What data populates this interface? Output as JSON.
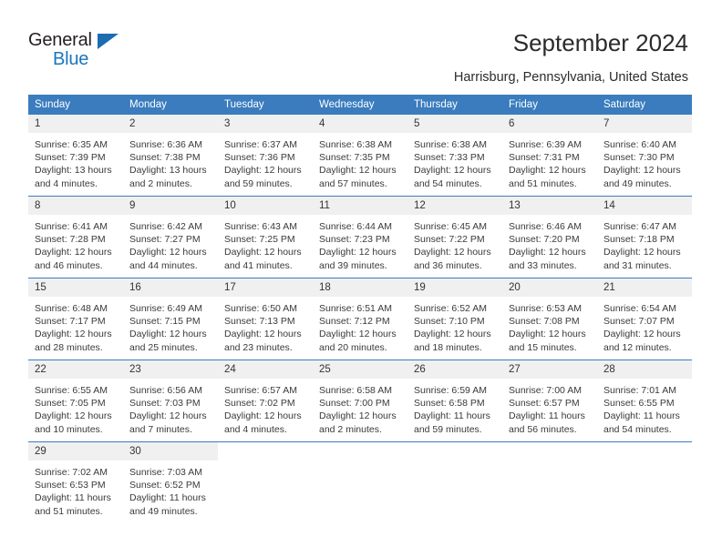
{
  "brand": {
    "name_top": "General",
    "name_bottom": "Blue",
    "triangle_color": "#1b6cb0",
    "blue_color": "#1b75bb"
  },
  "header": {
    "title": "September 2024",
    "subtitle": "Harrisburg, Pennsylvania, United States"
  },
  "calendar": {
    "header_bg": "#3a7cbe",
    "daynum_bg": "#f0f0f0",
    "weekdays": [
      "Sunday",
      "Monday",
      "Tuesday",
      "Wednesday",
      "Thursday",
      "Friday",
      "Saturday"
    ],
    "weeks": [
      [
        {
          "day": "1",
          "sunrise": "Sunrise: 6:35 AM",
          "sunset": "Sunset: 7:39 PM",
          "daylight1": "Daylight: 13 hours",
          "daylight2": "and 4 minutes."
        },
        {
          "day": "2",
          "sunrise": "Sunrise: 6:36 AM",
          "sunset": "Sunset: 7:38 PM",
          "daylight1": "Daylight: 13 hours",
          "daylight2": "and 2 minutes."
        },
        {
          "day": "3",
          "sunrise": "Sunrise: 6:37 AM",
          "sunset": "Sunset: 7:36 PM",
          "daylight1": "Daylight: 12 hours",
          "daylight2": "and 59 minutes."
        },
        {
          "day": "4",
          "sunrise": "Sunrise: 6:38 AM",
          "sunset": "Sunset: 7:35 PM",
          "daylight1": "Daylight: 12 hours",
          "daylight2": "and 57 minutes."
        },
        {
          "day": "5",
          "sunrise": "Sunrise: 6:38 AM",
          "sunset": "Sunset: 7:33 PM",
          "daylight1": "Daylight: 12 hours",
          "daylight2": "and 54 minutes."
        },
        {
          "day": "6",
          "sunrise": "Sunrise: 6:39 AM",
          "sunset": "Sunset: 7:31 PM",
          "daylight1": "Daylight: 12 hours",
          "daylight2": "and 51 minutes."
        },
        {
          "day": "7",
          "sunrise": "Sunrise: 6:40 AM",
          "sunset": "Sunset: 7:30 PM",
          "daylight1": "Daylight: 12 hours",
          "daylight2": "and 49 minutes."
        }
      ],
      [
        {
          "day": "8",
          "sunrise": "Sunrise: 6:41 AM",
          "sunset": "Sunset: 7:28 PM",
          "daylight1": "Daylight: 12 hours",
          "daylight2": "and 46 minutes."
        },
        {
          "day": "9",
          "sunrise": "Sunrise: 6:42 AM",
          "sunset": "Sunset: 7:27 PM",
          "daylight1": "Daylight: 12 hours",
          "daylight2": "and 44 minutes."
        },
        {
          "day": "10",
          "sunrise": "Sunrise: 6:43 AM",
          "sunset": "Sunset: 7:25 PM",
          "daylight1": "Daylight: 12 hours",
          "daylight2": "and 41 minutes."
        },
        {
          "day": "11",
          "sunrise": "Sunrise: 6:44 AM",
          "sunset": "Sunset: 7:23 PM",
          "daylight1": "Daylight: 12 hours",
          "daylight2": "and 39 minutes."
        },
        {
          "day": "12",
          "sunrise": "Sunrise: 6:45 AM",
          "sunset": "Sunset: 7:22 PM",
          "daylight1": "Daylight: 12 hours",
          "daylight2": "and 36 minutes."
        },
        {
          "day": "13",
          "sunrise": "Sunrise: 6:46 AM",
          "sunset": "Sunset: 7:20 PM",
          "daylight1": "Daylight: 12 hours",
          "daylight2": "and 33 minutes."
        },
        {
          "day": "14",
          "sunrise": "Sunrise: 6:47 AM",
          "sunset": "Sunset: 7:18 PM",
          "daylight1": "Daylight: 12 hours",
          "daylight2": "and 31 minutes."
        }
      ],
      [
        {
          "day": "15",
          "sunrise": "Sunrise: 6:48 AM",
          "sunset": "Sunset: 7:17 PM",
          "daylight1": "Daylight: 12 hours",
          "daylight2": "and 28 minutes."
        },
        {
          "day": "16",
          "sunrise": "Sunrise: 6:49 AM",
          "sunset": "Sunset: 7:15 PM",
          "daylight1": "Daylight: 12 hours",
          "daylight2": "and 25 minutes."
        },
        {
          "day": "17",
          "sunrise": "Sunrise: 6:50 AM",
          "sunset": "Sunset: 7:13 PM",
          "daylight1": "Daylight: 12 hours",
          "daylight2": "and 23 minutes."
        },
        {
          "day": "18",
          "sunrise": "Sunrise: 6:51 AM",
          "sunset": "Sunset: 7:12 PM",
          "daylight1": "Daylight: 12 hours",
          "daylight2": "and 20 minutes."
        },
        {
          "day": "19",
          "sunrise": "Sunrise: 6:52 AM",
          "sunset": "Sunset: 7:10 PM",
          "daylight1": "Daylight: 12 hours",
          "daylight2": "and 18 minutes."
        },
        {
          "day": "20",
          "sunrise": "Sunrise: 6:53 AM",
          "sunset": "Sunset: 7:08 PM",
          "daylight1": "Daylight: 12 hours",
          "daylight2": "and 15 minutes."
        },
        {
          "day": "21",
          "sunrise": "Sunrise: 6:54 AM",
          "sunset": "Sunset: 7:07 PM",
          "daylight1": "Daylight: 12 hours",
          "daylight2": "and 12 minutes."
        }
      ],
      [
        {
          "day": "22",
          "sunrise": "Sunrise: 6:55 AM",
          "sunset": "Sunset: 7:05 PM",
          "daylight1": "Daylight: 12 hours",
          "daylight2": "and 10 minutes."
        },
        {
          "day": "23",
          "sunrise": "Sunrise: 6:56 AM",
          "sunset": "Sunset: 7:03 PM",
          "daylight1": "Daylight: 12 hours",
          "daylight2": "and 7 minutes."
        },
        {
          "day": "24",
          "sunrise": "Sunrise: 6:57 AM",
          "sunset": "Sunset: 7:02 PM",
          "daylight1": "Daylight: 12 hours",
          "daylight2": "and 4 minutes."
        },
        {
          "day": "25",
          "sunrise": "Sunrise: 6:58 AM",
          "sunset": "Sunset: 7:00 PM",
          "daylight1": "Daylight: 12 hours",
          "daylight2": "and 2 minutes."
        },
        {
          "day": "26",
          "sunrise": "Sunrise: 6:59 AM",
          "sunset": "Sunset: 6:58 PM",
          "daylight1": "Daylight: 11 hours",
          "daylight2": "and 59 minutes."
        },
        {
          "day": "27",
          "sunrise": "Sunrise: 7:00 AM",
          "sunset": "Sunset: 6:57 PM",
          "daylight1": "Daylight: 11 hours",
          "daylight2": "and 56 minutes."
        },
        {
          "day": "28",
          "sunrise": "Sunrise: 7:01 AM",
          "sunset": "Sunset: 6:55 PM",
          "daylight1": "Daylight: 11 hours",
          "daylight2": "and 54 minutes."
        }
      ],
      [
        {
          "day": "29",
          "sunrise": "Sunrise: 7:02 AM",
          "sunset": "Sunset: 6:53 PM",
          "daylight1": "Daylight: 11 hours",
          "daylight2": "and 51 minutes."
        },
        {
          "day": "30",
          "sunrise": "Sunrise: 7:03 AM",
          "sunset": "Sunset: 6:52 PM",
          "daylight1": "Daylight: 11 hours",
          "daylight2": "and 49 minutes."
        },
        {
          "day": "",
          "sunrise": "",
          "sunset": "",
          "daylight1": "",
          "daylight2": ""
        },
        {
          "day": "",
          "sunrise": "",
          "sunset": "",
          "daylight1": "",
          "daylight2": ""
        },
        {
          "day": "",
          "sunrise": "",
          "sunset": "",
          "daylight1": "",
          "daylight2": ""
        },
        {
          "day": "",
          "sunrise": "",
          "sunset": "",
          "daylight1": "",
          "daylight2": ""
        },
        {
          "day": "",
          "sunrise": "",
          "sunset": "",
          "daylight1": "",
          "daylight2": ""
        }
      ]
    ]
  }
}
